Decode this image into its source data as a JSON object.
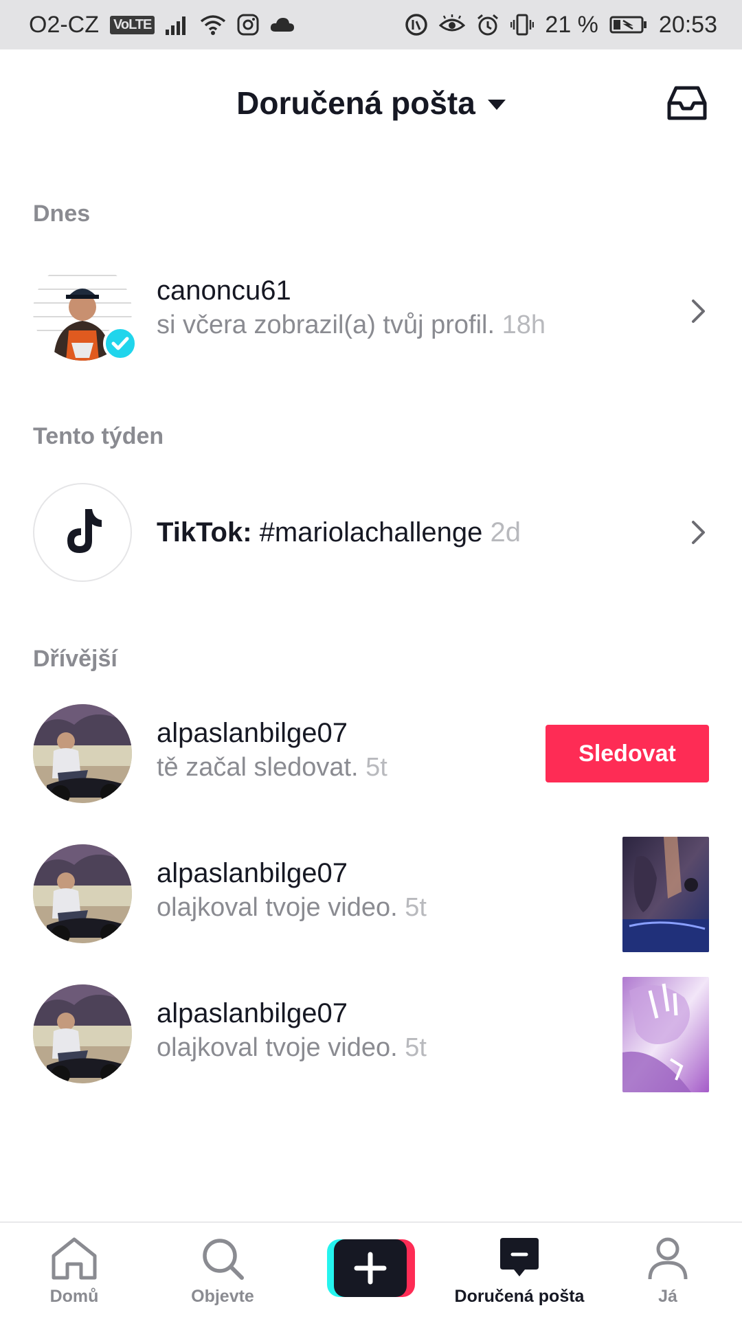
{
  "status_bar": {
    "carrier": "O2-CZ",
    "volte": "VoLTE",
    "battery_percent": "21 %",
    "time": "20:53"
  },
  "header": {
    "title": "Doručená pošta"
  },
  "sections": {
    "today": "Dnes",
    "this_week": "Tento týden",
    "earlier": "Dřívější"
  },
  "notifications": {
    "profile_view": {
      "username": "canoncu61",
      "text": "si včera zobrazil(a) tvůj profil.",
      "time": "18h"
    },
    "tiktok": {
      "prefix": "TikTok:",
      "text": "#mariolachallenge",
      "time": "2d"
    },
    "follow": {
      "username": "alpaslanbilge07",
      "text": "tě začal sledovat.",
      "time": "5t",
      "button": "Sledovat"
    },
    "like1": {
      "username": "alpaslanbilge07",
      "text": "olajkoval tvoje video.",
      "time": "5t"
    },
    "like2": {
      "username": "alpaslanbilge07",
      "text": "olajkoval tvoje video.",
      "time": "5t"
    }
  },
  "nav": {
    "home": "Domů",
    "discover": "Objevte",
    "inbox": "Doručená pošta",
    "me": "Já"
  },
  "colors": {
    "accent": "#fe2c55",
    "verified": "#20d5ec",
    "muted": "#8a8b91"
  }
}
